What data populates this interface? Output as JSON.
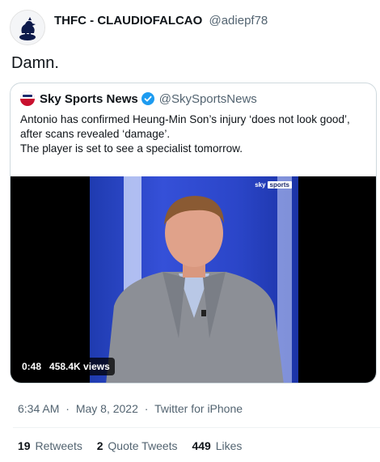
{
  "tweet": {
    "author_name": "THFC - CLAUDIOFALCAO",
    "author_handle": "@adiepf78",
    "text": "Damn.",
    "avatar_icon": "rooster-crest-icon"
  },
  "quoted_tweet": {
    "author_name": "Sky Sports News",
    "author_handle": "@SkySportsNews",
    "verified_icon": "verified-badge-icon",
    "text_lines": [
      "Antonio has confirmed Heung-Min Son’s  injury ‘does not look good’,",
      "after scans revealed ‘damage’.",
      "The player is set to see a specialist tomorrow."
    ],
    "video": {
      "duration": "0:48",
      "views": "458.4K views",
      "watermark_sky": "sky",
      "watermark_sports": "sports"
    }
  },
  "meta": {
    "time": "6:34 AM",
    "separator": "·",
    "date": "May 8, 2022",
    "source": "Twitter for iPhone"
  },
  "stats": {
    "retweets_count": "19",
    "retweets_label": "Retweets",
    "quotes_count": "2",
    "quotes_label": "Quote Tweets",
    "likes_count": "449",
    "likes_label": "Likes"
  },
  "colors": {
    "text": "#0f1419",
    "secondary": "#536471",
    "border": "#cfd9de",
    "verified": "#1d9bf0",
    "studio_blue": "#2b46c9"
  }
}
